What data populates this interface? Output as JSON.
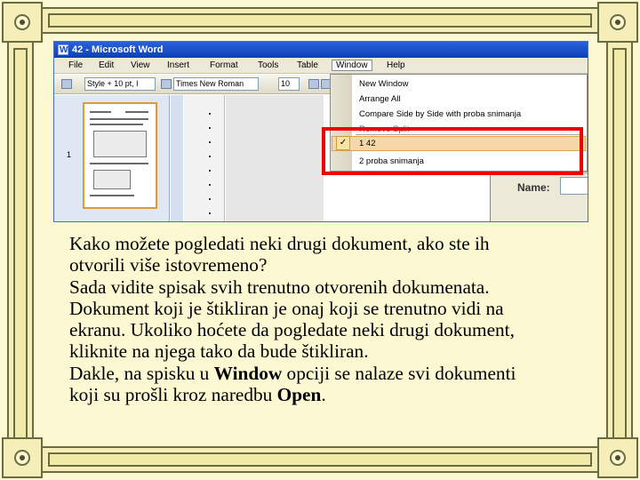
{
  "screenshot": {
    "window_title": "42 - Microsoft Word",
    "menu": [
      "File",
      "Edit",
      "View",
      "Insert",
      "Format",
      "Tools",
      "Table",
      "Window",
      "Help"
    ],
    "active_menu": "Window",
    "toolbar": {
      "style_value": "Style + 10 pt, l",
      "font_value": "Times New Roman",
      "size_value": "10"
    },
    "page_number": "1",
    "window_menu_items": [
      "New Window",
      "Arrange All",
      "Compare Side by Side with proba snimanja",
      "Remove Split",
      "1 42",
      "2 proba snimanja"
    ],
    "checked_item_index": 4,
    "dialog_label": "Name:"
  },
  "body": {
    "lines": [
      "Kako možete pogledati neki drugi dokument, ako ste ih",
      "otvorili više istovremeno?",
      "Sada vidite spisak svih trenutno otvorenih dokumenata.",
      "Dokument koji je štikliran je onaj koji se trenutno vidi na",
      "ekranu. Ukoliko hoćete da pogledate neki drugi dokument,",
      "kliknite na njega tako da bude štikliran."
    ],
    "line7_prefix": "Dakle, na spisku u ",
    "line7_bold": "Window",
    "line7_suffix": " opciji se nalaze svi dokumenti",
    "line8_prefix": "koji su prošli kroz naredbu ",
    "line8_bold": "Open",
    "line8_suffix": "."
  }
}
